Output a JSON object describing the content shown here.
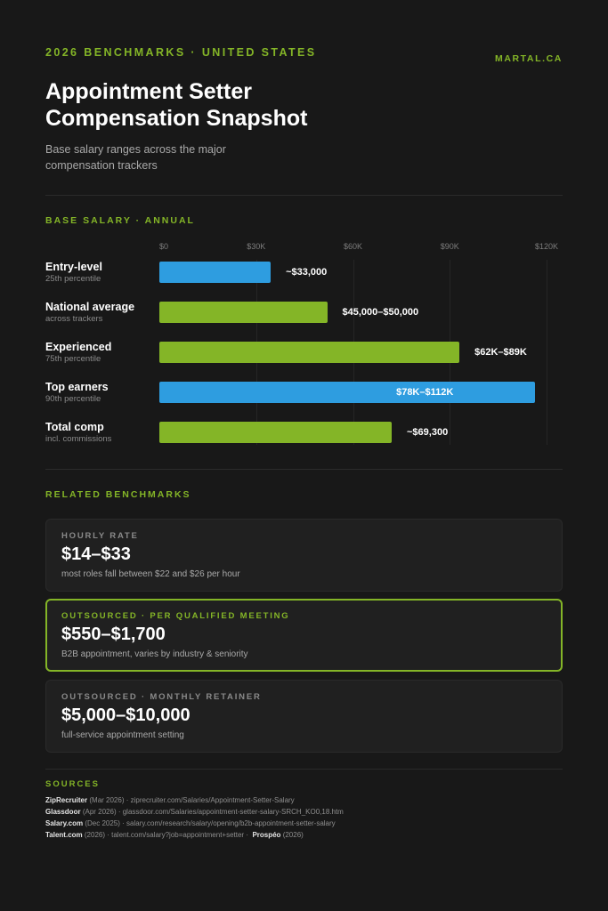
{
  "header": {
    "kicker": "2026 BENCHMARKS · UNITED STATES",
    "site": "MARTAL.CA",
    "title": "Appointment Setter Compensation Snapshot",
    "subtitle": "Base salary ranges across the major compensation trackers"
  },
  "colors": {
    "accent": "#84b527",
    "blue": "#2e9de0",
    "background": "#181818"
  },
  "chart_section_label": "BASE SALARY · ANNUAL",
  "chart_data": {
    "type": "bar",
    "orientation": "horizontal",
    "title": "BASE SALARY · ANNUAL",
    "xlim": [
      0,
      120000
    ],
    "ticks": [
      0,
      30000,
      60000,
      90000,
      120000
    ],
    "tick_labels": [
      "$0",
      "$30K",
      "$60K",
      "$90K",
      "$120K"
    ],
    "grid": true,
    "rows": [
      {
        "label": "Entry-level",
        "sublabel": "25th percentile",
        "value": 34500,
        "value_label": "~$33,000",
        "color": "#2e9de0",
        "label_inside": false
      },
      {
        "label": "National average",
        "sublabel": "across trackers",
        "value": 52000,
        "value_label": "$45,000–$50,000",
        "color": "#84b527",
        "label_inside": false
      },
      {
        "label": "Experienced",
        "sublabel": "75th percentile",
        "value": 93000,
        "value_label": "$62K–$89K",
        "color": "#84b527",
        "label_inside": false
      },
      {
        "label": "Top earners",
        "sublabel": "90th percentile",
        "value": 116500,
        "value_label": "$78K–$112K",
        "color": "#2e9de0",
        "label_inside": true
      },
      {
        "label": "Total comp",
        "sublabel": "incl. commissions",
        "value": 72000,
        "value_label": "~$69,300",
        "color": "#84b527",
        "label_inside": false
      }
    ]
  },
  "related": {
    "label": "RELATED BENCHMARKS",
    "cards": [
      {
        "label": "HOURLY RATE",
        "value": "$14–$33",
        "note": "most roles fall between $22 and $26 per hour"
      },
      {
        "label": "OUTSOURCED · PER QUALIFIED MEETING",
        "value": "$550–$1,700",
        "note": "B2B appointment, varies by industry & seniority"
      },
      {
        "label": "OUTSOURCED · MONTHLY RETAINER",
        "value": "$5,000–$10,000",
        "note": "full-service appointment setting"
      }
    ]
  },
  "sources": {
    "label": "SOURCES",
    "items": [
      {
        "name": "ZipRecruiter",
        "date": "(Mar 2026)",
        "url": "· ziprecruiter.com/Salaries/Appointment-Setter-Salary"
      },
      {
        "name": "Glassdoor",
        "date": "(Apr 2026)",
        "url": "· glassdoor.com/Salaries/appointment-setter-salary-SRCH_KO0,18.htm"
      },
      {
        "name": "Salary.com",
        "date": "(Dec 2025)",
        "url": "· salary.com/research/salary/opening/b2b-appointment-setter-salary"
      },
      {
        "name": "Talent.com",
        "date": "(2026)",
        "url": "· talent.com/salary?job=appointment+setter ·"
      }
    ],
    "extra": {
      "name": "Prospéo",
      "date": "(2026)"
    }
  }
}
